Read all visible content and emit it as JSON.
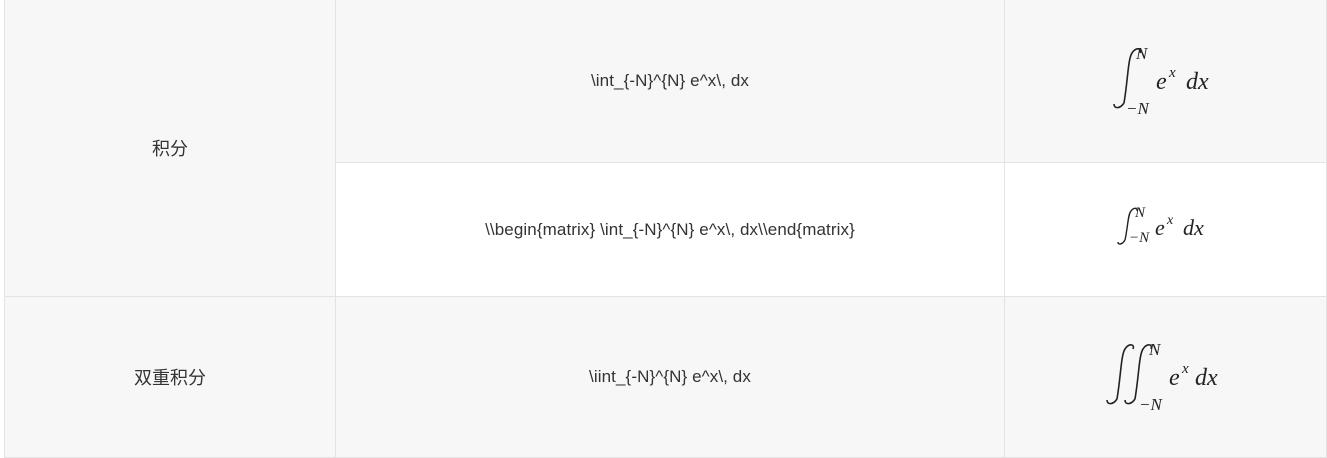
{
  "rows": [
    {
      "category": "积分",
      "items": [
        {
          "code": "\\int_{-N}^{N} e^x\\, dx",
          "rendering": {
            "operator": "∫",
            "lower": "−N",
            "upper": "N",
            "body": "e",
            "exp": "x",
            "diff": "dx",
            "style": "display"
          }
        },
        {
          "code": "\\\\begin{matrix} \\int_{-N}^{N} e^x\\, dx\\\\end{matrix}",
          "rendering": {
            "operator": "∫",
            "lower": "−N",
            "upper": "N",
            "body": "e",
            "exp": "x",
            "diff": "dx",
            "style": "inline"
          }
        }
      ]
    },
    {
      "category": "双重积分",
      "items": [
        {
          "code": "\\iint_{-N}^{N} e^x\\, dx",
          "rendering": {
            "operator": "∬",
            "lower": "−N",
            "upper": "N",
            "body": "e",
            "exp": "x",
            "diff": "dx",
            "style": "display-double"
          }
        }
      ]
    }
  ]
}
